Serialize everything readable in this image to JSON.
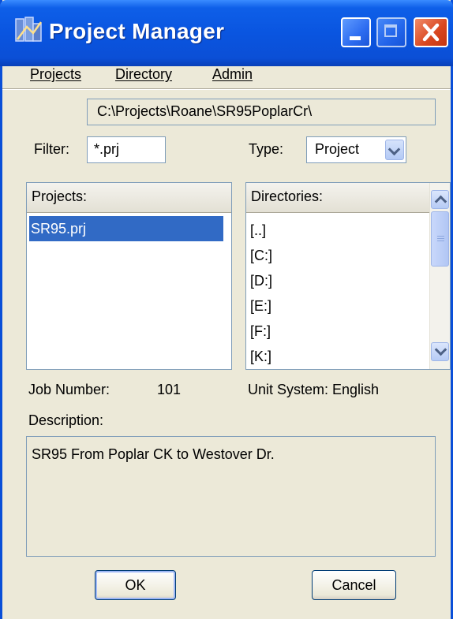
{
  "window": {
    "title": "Project Manager",
    "icon": "project-manager-app-icon",
    "controls": {
      "minimize": "minimize-icon",
      "maximize": "maximize-icon",
      "close": "close-icon"
    }
  },
  "menu": {
    "items": [
      {
        "label": "Projects"
      },
      {
        "label": "Directory"
      },
      {
        "label": "Admin"
      }
    ]
  },
  "path": "C:\\Projects\\Roane\\SR95PoplarCr\\",
  "filter": {
    "label": "Filter:",
    "value": "*.prj"
  },
  "type": {
    "label": "Type:",
    "value": "Project"
  },
  "projects": {
    "header": "Projects:",
    "items": [
      "SR95.prj"
    ],
    "selected_index": 0
  },
  "directories": {
    "header": "Directories:",
    "items": [
      "[..]",
      "[C:]",
      "[D:]",
      "[E:]",
      "[F:]",
      "[K:]"
    ]
  },
  "job_number": {
    "label": "Job Number:",
    "value": "101"
  },
  "unit_system": "Unit System: English",
  "description": {
    "label": "Description:",
    "value": "SR95 From Poplar CK to Westover Dr."
  },
  "buttons": {
    "ok": "OK",
    "cancel": "Cancel"
  },
  "colors": {
    "titlebar": "#0a55e0",
    "dialog_bg": "#ece9d8",
    "selection": "#316ac5",
    "close_button": "#d9461f"
  }
}
